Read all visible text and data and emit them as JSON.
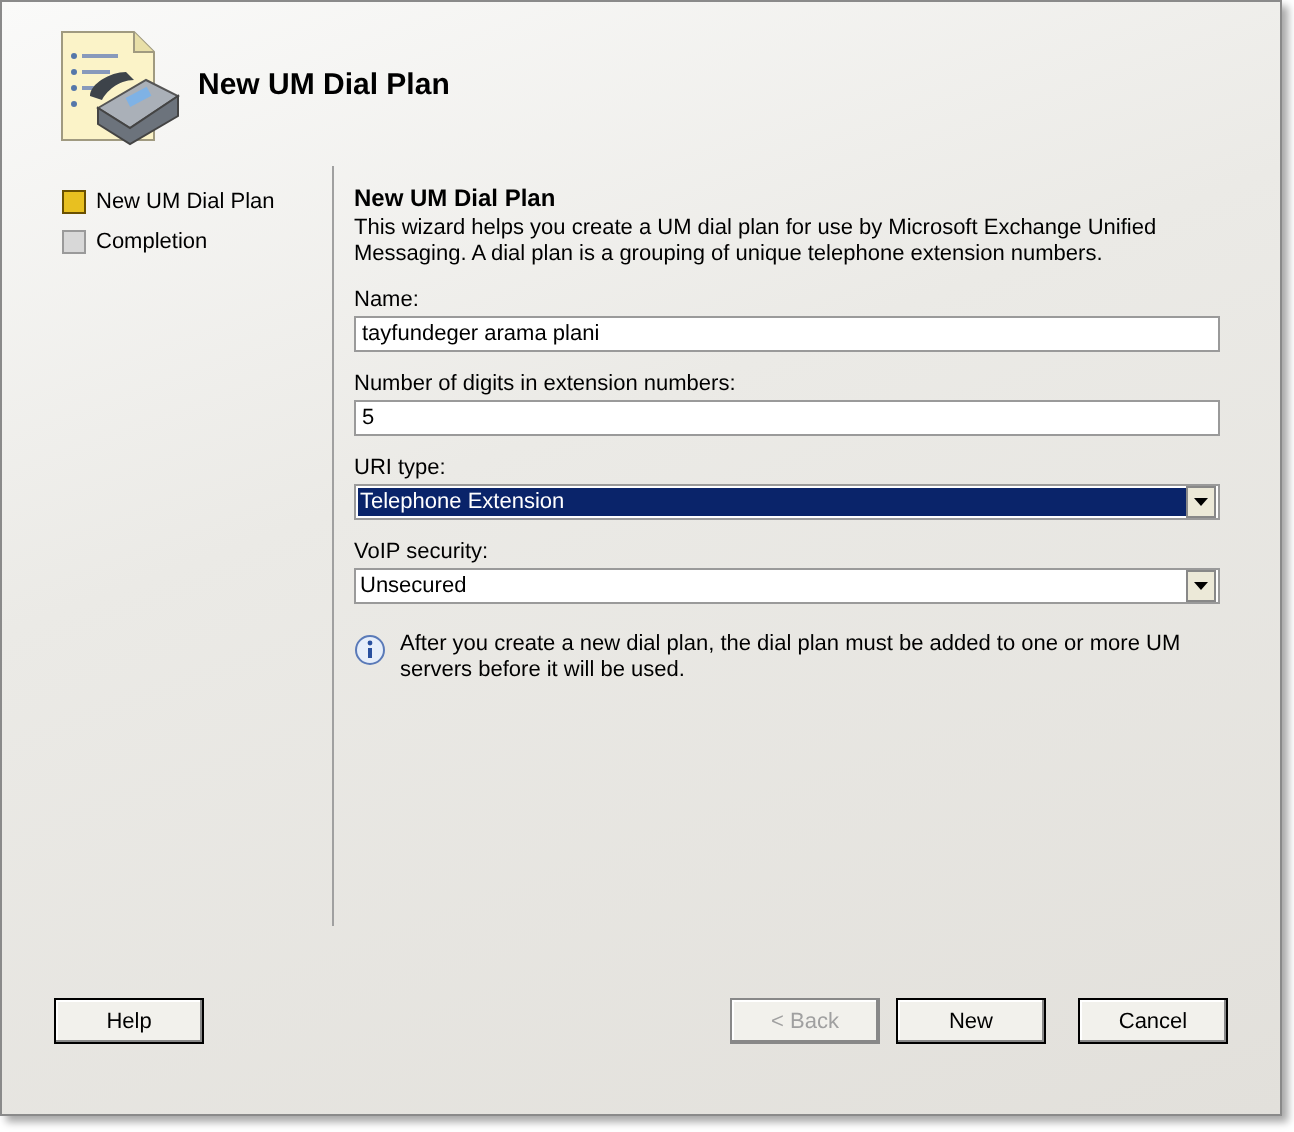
{
  "header": {
    "title": "New UM Dial Plan"
  },
  "steps": [
    {
      "label": "New UM Dial Plan",
      "selected": true
    },
    {
      "label": "Completion",
      "selected": false
    }
  ],
  "content": {
    "title": "New UM Dial Plan",
    "intro": "This wizard helps you create a UM dial plan for use by Microsoft Exchange Unified Messaging. A dial plan is a grouping of unique telephone extension numbers.",
    "fields": [
      {
        "kind": "text",
        "label": "Name:",
        "value": "tayfundeger arama plani",
        "focused": false
      },
      {
        "kind": "text",
        "label": "Number of digits in extension numbers:",
        "value": "5",
        "focused": false
      },
      {
        "kind": "dropdown",
        "label": "URI type:",
        "value": "Telephone Extension",
        "focused": true
      },
      {
        "kind": "dropdown",
        "label": "VoIP security:",
        "value": "Unsecured",
        "focused": false
      }
    ],
    "note": "After you create a new dial plan, the dial plan must be added to one or more UM servers before it will be used."
  },
  "buttons": [
    {
      "label": "Help",
      "disabled": false,
      "kind": "left"
    },
    {
      "label": "< Back",
      "disabled": true,
      "kind": "right"
    },
    {
      "label": "New",
      "disabled": false,
      "kind": "right"
    },
    {
      "label": "Cancel",
      "disabled": false,
      "kind": "right"
    }
  ]
}
